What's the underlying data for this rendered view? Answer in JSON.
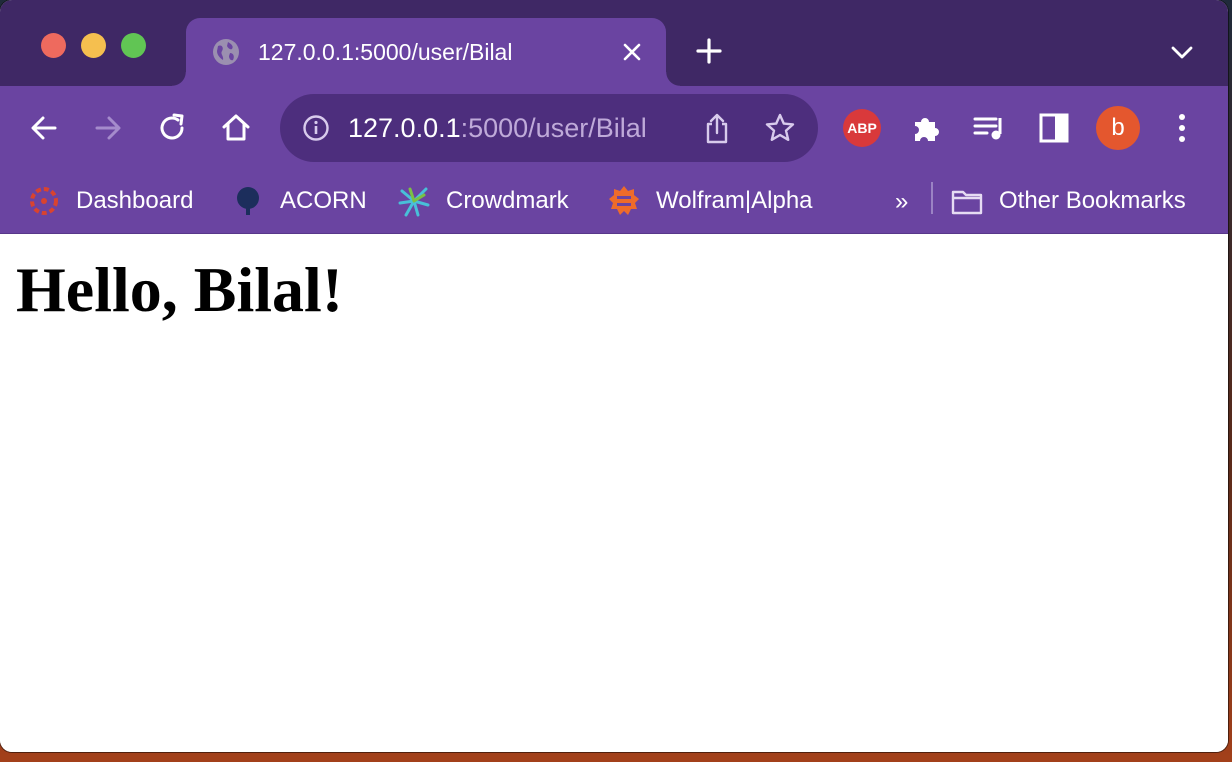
{
  "browser": {
    "tab": {
      "title": "127.0.0.1:5000/user/Bilal"
    },
    "address": {
      "host": "127.0.0.1",
      "rest": ":5000/user/Bilal"
    },
    "extensions": {
      "abp_label": "ABP"
    },
    "profile": {
      "initial": "b"
    },
    "bookmarks": [
      {
        "label": "Dashboard",
        "icon": "canvas-icon"
      },
      {
        "label": "ACORN",
        "icon": "tree-icon"
      },
      {
        "label": "Crowdmark",
        "icon": "crowdmark-icon"
      },
      {
        "label": "Wolfram|Alpha",
        "icon": "wolfram-icon"
      }
    ],
    "bookmarks_more": "»",
    "other_bookmarks": "Other Bookmarks"
  },
  "page": {
    "heading": "Hello, Bilal!"
  },
  "colors": {
    "tabstrip": "#3f2865",
    "toolbar": "#6a44a1",
    "omnibox": "#4d2e7d",
    "avatar": "#e4572e",
    "abp": "#d9393b"
  }
}
